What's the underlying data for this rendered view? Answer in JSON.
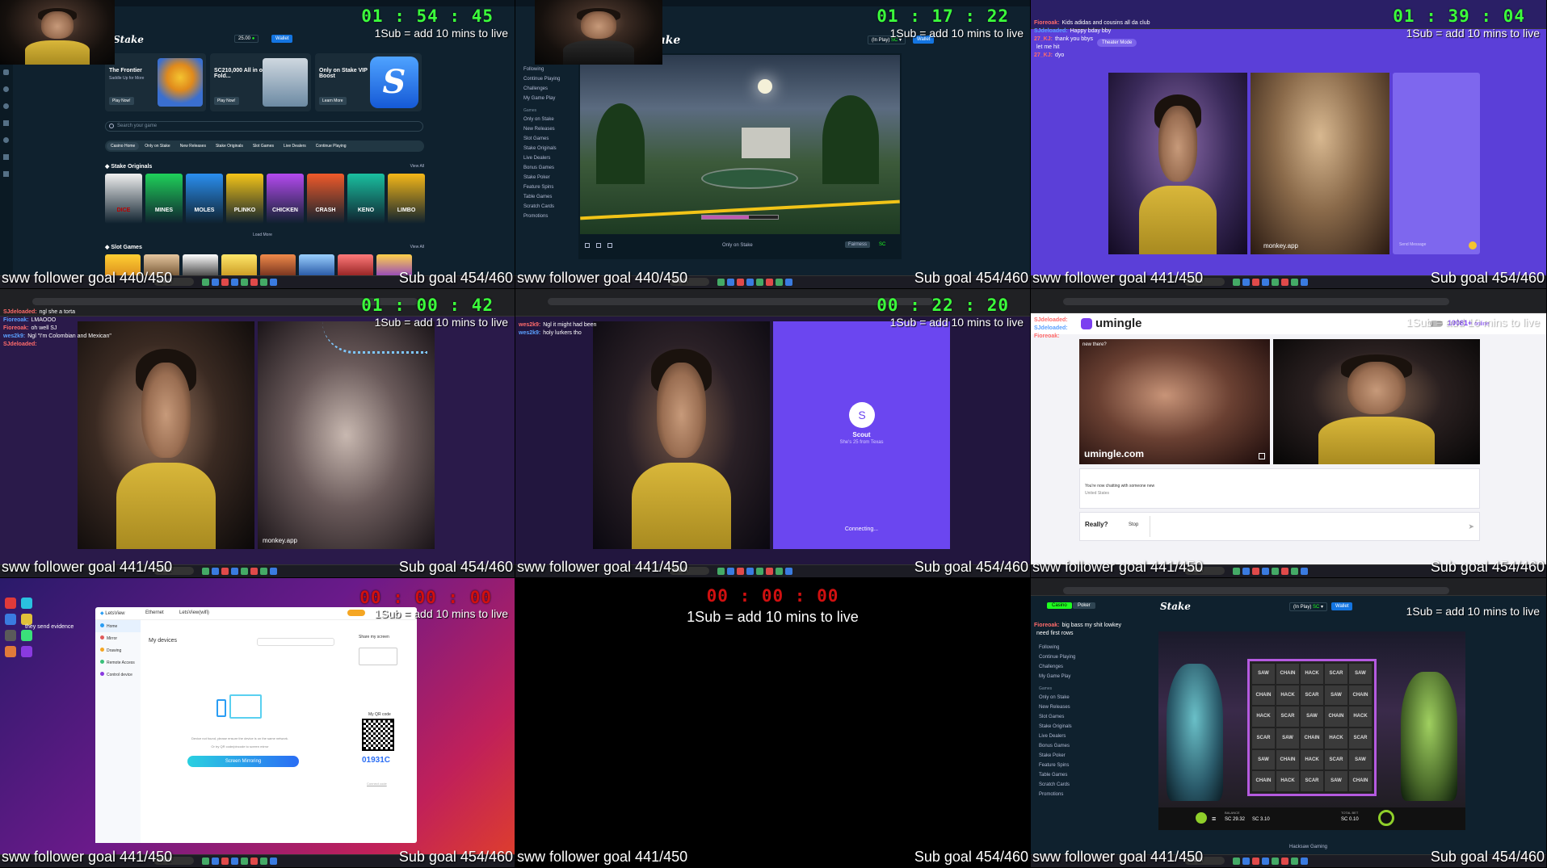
{
  "tiles": [
    {
      "timer": "01 : 54 : 45",
      "subline": "1Sub = add 10 mins to live",
      "follower_goal": "sww follower goal 440/450",
      "sub_goal": "Sub goal 454/460",
      "stake": {
        "logo": "Stake",
        "balance": "25.00",
        "wallet": "Wallet",
        "promo1_title": "The Frontier",
        "promo1_sub": "Saddle Up for More",
        "promo1_btn": "Play Now!",
        "promo2_title": "SC210,000 All in or Fold...",
        "promo2_btn": "Play Now!",
        "promo3_title": "Only on Stake VIP Boost",
        "promo3_btn": "Learn More",
        "search_placeholder": "Search your game",
        "tabs": [
          "Casino Home",
          "Only on Stake",
          "New Releases",
          "Stake Originals",
          "Slot Games",
          "Live Dealers",
          "Continue Playing"
        ],
        "originals_heading": "Stake Originals",
        "view_all": "View All",
        "originals": [
          "DICE",
          "MINES",
          "MOLES",
          "PLINKO",
          "CHICKEN",
          "CRASH",
          "KENO",
          "LIMBO"
        ],
        "load_more": "Load More",
        "slot_heading": "Slot Games"
      }
    },
    {
      "timer": "01 : 17 : 22",
      "subline": "1Sub = add 10 mins to live",
      "follower_goal": "sww follower goal 440/450",
      "sub_goal": "Sub goal 454/460",
      "stake": {
        "logo": "Stake",
        "balance_label": "(In Play)",
        "balance_currency": "SC",
        "wallet": "Wallet",
        "sidebar": [
          "Following",
          "Continue Playing",
          "Challenges",
          "My Game Play"
        ],
        "sidebar_section": "Games",
        "sidebar_games": [
          "Only on Stake",
          "New Releases",
          "Slot Games",
          "Stake Originals",
          "Live Dealers",
          "Bonus Games",
          "Stake Poker",
          "Feature Spins",
          "Table Games",
          "Scratch Cards",
          "Promotions"
        ],
        "game_footer": "Only on Stake",
        "fairness": "Fairness",
        "currency": "SC"
      }
    },
    {
      "timer": "01 : 39 : 04",
      "subline": "1Sub = add 10 mins to live",
      "follower_goal": "sww follower goal 441/450",
      "sub_goal": "Sub goal 454/460",
      "chat": [
        {
          "name": "Fioreoak:",
          "msg": "Kids adidas and cousins all da club"
        },
        {
          "name": "SJdeloaded:",
          "msg": "Happy bday bby"
        },
        {
          "name": "27_KJ:",
          "msg": "thank you bbys"
        },
        {
          "name": "",
          "msg": "let me hit"
        },
        {
          "name": "27_KJ:",
          "msg": "dyo"
        }
      ],
      "theater_btn": "Theater Mode",
      "monkey_label": "monkey.app",
      "send_placeholder": "Send Message"
    },
    {
      "timer": "01 : 00 : 42",
      "subline": "1Sub = add 10 mins to live",
      "follower_goal": "sww follower goal 441/450",
      "sub_goal": "Sub goal 454/460",
      "chat": [
        {
          "name": "SJdeloaded:",
          "msg": "ngl she a torta"
        },
        {
          "name": "Fioreoak:",
          "msg": "LMAOOO"
        },
        {
          "name": "Fioreoak:",
          "msg": "oh well SJ"
        },
        {
          "name": "wes2k9:",
          "msg": "Ngl \"I'm Colombian and Mexican\""
        },
        {
          "name": "SJdeloaded:",
          "msg": ""
        }
      ],
      "monkey_label": "monkey.app"
    },
    {
      "timer": "00 : 22 : 20",
      "subline": "1Sub = add 10 mins to live",
      "follower_goal": "sww follower goal 441/450",
      "sub_goal": "Sub goal 454/460",
      "chat": [
        {
          "name": "wes2k9:",
          "msg": "Ngl it might had been"
        },
        {
          "name": "wes2k9:",
          "msg": "holy lurkers tho"
        }
      ],
      "scout_initial": "S",
      "scout_name": "Scout",
      "scout_sub": "She's 25 from Texas",
      "connecting": "Connecting..."
    },
    {
      "timer": "",
      "subline": "1Sub = add 10 mins to live",
      "follower_goal": "sww follower goal 441/450",
      "sub_goal": "Sub goal 454/460",
      "logo": "umingle",
      "online": "10081+",
      "online_label": "online",
      "greeting": "new there?",
      "chat_notice": "You're now chatting with someone new",
      "country": "United States",
      "really_btn": "Really?",
      "stop_btn": "Stop",
      "watermark": "umingle.com",
      "chat": [
        {
          "name": "SJdeloaded:",
          "msg": ""
        },
        {
          "name": "SJdeloaded:",
          "msg": ""
        },
        {
          "name": "Fioreoak:",
          "msg": ""
        }
      ]
    },
    {
      "timer": "00 : 00 : 00",
      "subline": "1Sub = add 10 mins to live",
      "follower_goal": "sww follower goal 441/450",
      "sub_goal": "Sub goal 454/460",
      "chat": [
        {
          "name": "",
          "msg": "they send evidence"
        }
      ],
      "app_name": "LetsView",
      "app_tabs": [
        "Ethernet",
        "LetsView(wifi)"
      ],
      "menu": [
        "Home",
        "Mirror",
        "Drawing",
        "Remote Access",
        "Control device"
      ],
      "devices_heading": "My devices",
      "share_heading": "Share my screen",
      "no_device": "Device not found, please ensure the device is on the same network.",
      "qr_hint": "Or try QR code/pincode to screen mirror",
      "screen_mirror_btn": "Screen Mirroring",
      "qr_heading": "My QR code",
      "pin_code": "01931C",
      "connect_link": "Connect code"
    },
    {
      "timer": "00 : 00 : 00",
      "subline": "1Sub = add 10 mins to live",
      "follower_goal": "sww follower goal 441/450",
      "sub_goal": "Sub goal 454/460"
    },
    {
      "timer": "",
      "subline": "1Sub = add 10 mins to live",
      "follower_goal": "sww follower goal 441/450",
      "sub_goal": "Sub goal 454/460",
      "chat": [
        {
          "name": "Fioreoak:",
          "msg": "big bass my shit lowkey"
        },
        {
          "name": "",
          "msg": "need first rows"
        }
      ],
      "stake": {
        "logo": "Stake",
        "balance_label": "(In Play)",
        "balance_currency": "SC",
        "wallet": "Wallet",
        "tabs": [
          "Casino",
          "Poker"
        ],
        "sidebar": [
          "Following",
          "Continue Playing",
          "Challenges",
          "My Game Play"
        ],
        "sidebar_section": "Games",
        "sidebar_games": [
          "Only on Stake",
          "New Releases",
          "Slot Games",
          "Stake Originals",
          "Live Dealers",
          "Bonus Games",
          "Stake Poker",
          "Feature Spins",
          "Table Games",
          "Scratch Cards",
          "Promotions"
        ],
        "reel_symbols": [
          "SCAR",
          "HACK",
          "CHAIN",
          "SAW"
        ],
        "balance_label2": "BALANCE",
        "balance_val": "SC 29.32",
        "win_val": "SC 3.10",
        "bet_label": "TOTAL BET",
        "bet_val": "SC 0.10",
        "game_title": "Hacksaw Gaming",
        "currency": "SC"
      }
    }
  ]
}
